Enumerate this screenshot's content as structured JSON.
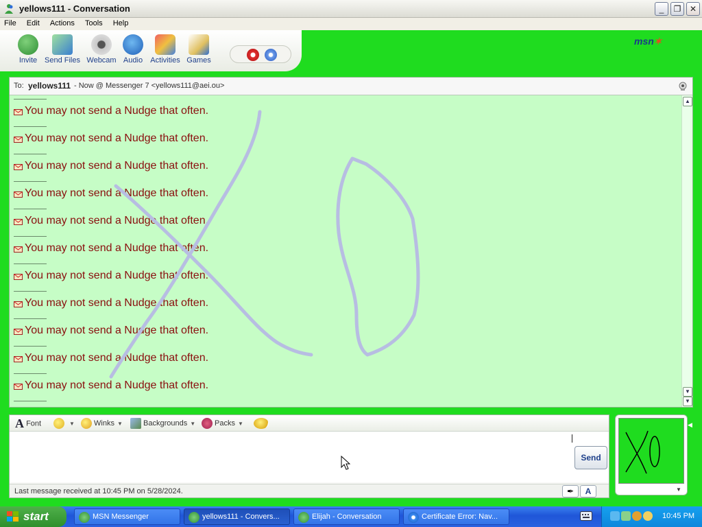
{
  "window": {
    "title": "yellows111 - Conversation",
    "controls": [
      "_",
      "❐",
      "✕"
    ]
  },
  "menu": [
    "File",
    "Edit",
    "Actions",
    "Tools",
    "Help"
  ],
  "toolbar": {
    "items": [
      {
        "label": "Invite",
        "icon": "invite-icon"
      },
      {
        "label": "Send Files",
        "icon": "send-files-icon"
      },
      {
        "label": "Webcam",
        "icon": "webcam-icon"
      },
      {
        "label": "Audio",
        "icon": "audio-icon"
      },
      {
        "label": "Activities",
        "icon": "activities-icon"
      },
      {
        "label": "Games",
        "icon": "games-icon"
      }
    ],
    "block_icons": [
      "block-icon",
      "pen-icon"
    ],
    "brand": "msn"
  },
  "conversation": {
    "to_prefix": "To:",
    "to_name": "yellows111",
    "to_detail": "- Now @ Messenger 7 <yellows111@aei.ou>",
    "messages": [
      "You may not send a Nudge that often.",
      "You may not send a Nudge that often.",
      "You may not send a Nudge that often.",
      "You may not send a Nudge that often.",
      "You may not send a Nudge that often.",
      "You may not send a Nudge that often.",
      "You may not send a Nudge that often.",
      "You may not send a Nudge that often.",
      "You may not send a Nudge that often.",
      "You may not send a Nudge that often.",
      "You may not send a Nudge that often."
    ],
    "ink_color": "#b7bde2",
    "text_color": "#8a0e0e",
    "background": "#c6fdc6"
  },
  "compose": {
    "toolbar": [
      {
        "label": "Font",
        "icon": "font-icon"
      },
      {
        "label": "",
        "icon": "emoticon-icon"
      },
      {
        "label": "Winks",
        "icon": "winks-icon"
      },
      {
        "label": "Backgrounds",
        "icon": "backgrounds-icon"
      },
      {
        "label": "Packs",
        "icon": "packs-icon"
      },
      {
        "label": "",
        "icon": "nudge-icon"
      }
    ],
    "input_value": "",
    "send_label": "Send",
    "status": "Last message received at 10:45 PM on 5/28/2024."
  },
  "taskbar": {
    "start_label": "start",
    "tasks": [
      {
        "label": "MSN Messenger",
        "icon": "msn-icon",
        "active": false
      },
      {
        "label": "yellows111 - Convers...",
        "icon": "msn-icon",
        "active": true
      },
      {
        "label": "Elijah - Conversation",
        "icon": "msn-icon",
        "active": false
      },
      {
        "label": "Certificate Error: Nav...",
        "icon": "ie-icon",
        "active": false
      }
    ],
    "clock": "10:45 PM"
  },
  "colors": {
    "theme_green": "#1fdc1f",
    "chat_bg": "#c6fdc6",
    "xp_blue": "#2a62e0"
  }
}
